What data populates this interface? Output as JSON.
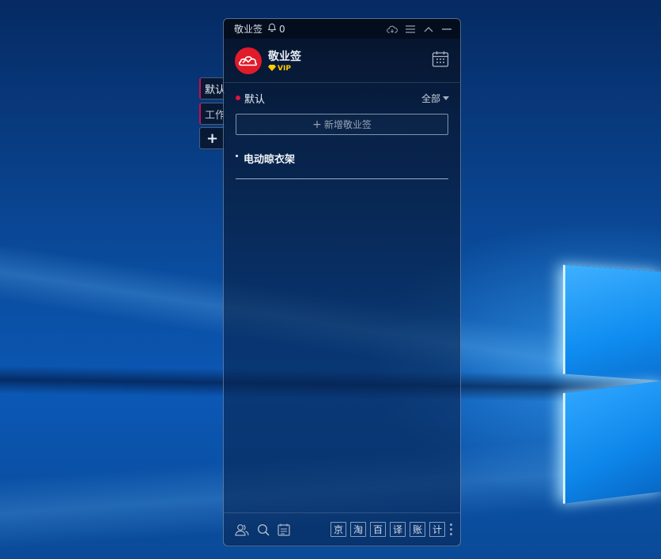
{
  "titlebar": {
    "app_name": "敬业签",
    "reminder_count": "0"
  },
  "header": {
    "brand_name": "敬业签",
    "vip_label": "VIP"
  },
  "side_tabs": [
    {
      "label": "默认"
    },
    {
      "label": "工作"
    },
    {
      "label": "+"
    }
  ],
  "section": {
    "title": "默认",
    "filter_label": "全部"
  },
  "add_button": {
    "label": "新增敬业签"
  },
  "notes": [
    {
      "text": "电动晾衣架"
    }
  ],
  "quick_tools": [
    "京",
    "淘",
    "百",
    "译",
    "账",
    "计"
  ],
  "colors": {
    "accent_red": "#e01b2a",
    "vip_gold": "#ffcc00",
    "category_dot": "#e0143c"
  },
  "icons": {
    "titlebar": [
      "bell-icon",
      "cloud-sync-icon",
      "menu-icon",
      "collapse-icon",
      "minimize-icon"
    ],
    "header": [
      "cloud-logo-icon",
      "diamond-icon",
      "calendar-icon"
    ],
    "footer": [
      "users-icon",
      "search-icon",
      "note-list-icon",
      "more-icon"
    ]
  }
}
